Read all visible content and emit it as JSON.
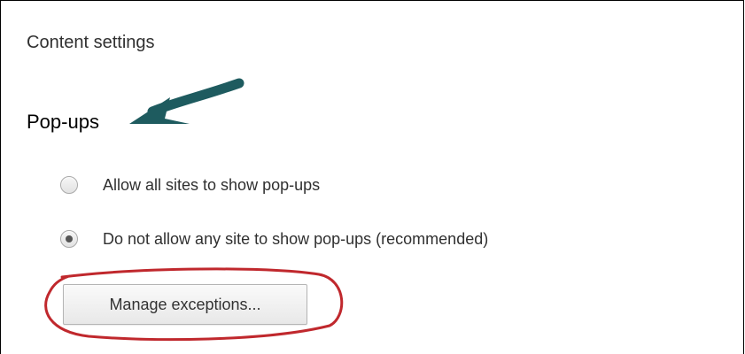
{
  "content_settings": {
    "title": "Content settings",
    "popups": {
      "heading": "Pop-ups",
      "options": [
        {
          "label": "Allow all sites to show pop-ups",
          "selected": false
        },
        {
          "label": "Do not allow any site to show pop-ups (recommended)",
          "selected": true
        }
      ],
      "manage_button_label": "Manage exceptions..."
    }
  },
  "annotations": {
    "arrow_color": "#1e5b5f",
    "highlight_color": "#c0282d",
    "arrow_icon": "arrow-icon",
    "highlight_shape": "ellipse"
  }
}
